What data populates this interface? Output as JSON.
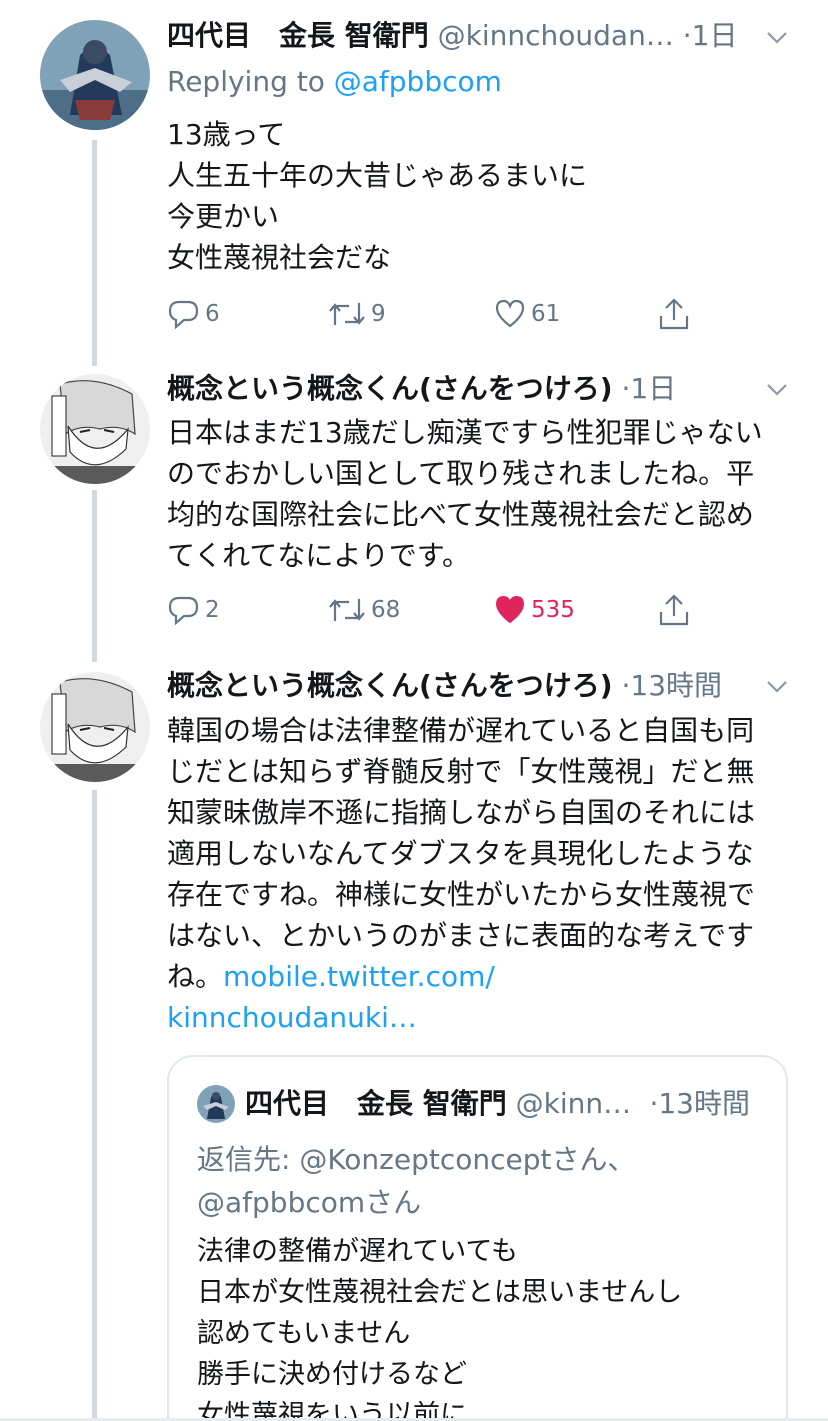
{
  "colors": {
    "accent": "#1da1f2",
    "muted": "#657786",
    "like": "#e0245e",
    "line": "#cfd9de"
  },
  "tweets": [
    {
      "name": "四代目　金長 智衛門",
      "handle": "@kinnchoudan…",
      "dot": "·",
      "time": "1日",
      "reply_prefix": "Replying to ",
      "reply_mention": "@afpbbcom",
      "body": "13歳って\n人生五十年の大昔じゃあるまいに\n今更かい\n女性蔑視社会だな",
      "replies": "6",
      "retweets": "9",
      "likes": "61",
      "liked": false
    },
    {
      "name": "概念という概念くん(さんをつけろ)",
      "dot": "·",
      "time": "1日",
      "body": "日本はまだ13歳だし痴漢ですら性犯罪じゃないのでおかしい国として取り残されましたね。平均的な国際社会に比べて女性蔑視社会だと認めてくれてなによりです。",
      "replies": "2",
      "retweets": "68",
      "likes": "535",
      "liked": true
    },
    {
      "name": "概念という概念くん(さんをつけろ)",
      "dot": "·",
      "time": "13時間",
      "body": "韓国の場合は法律整備が遅れていると自国も同じだとは知らず脊髄反射で「女性蔑視」だと無知蒙昧傲岸不遜に指摘しながら自国のそれには適用しないなんてダブスタを具現化したような存在ですね。神様に女性がいたから女性蔑視ではない、とかいうのがまさに表面的な考えですね。",
      "link": "mobile.twitter.com/\nkinnchoudanuki…"
    }
  ],
  "quote": {
    "name": "四代目　金長 智衛門",
    "handle": "@kinn…",
    "dot": "·",
    "time": "13時間",
    "reply": "返信先: @Konzeptconceptさん、\n@afpbbcomさん",
    "body": "法律の整備が遅れていても\n日本が女性蔑視社会だとは思いませんし\n認めてもいません\n勝手に決め付けるなど\n女性蔑視をいう以前に"
  }
}
